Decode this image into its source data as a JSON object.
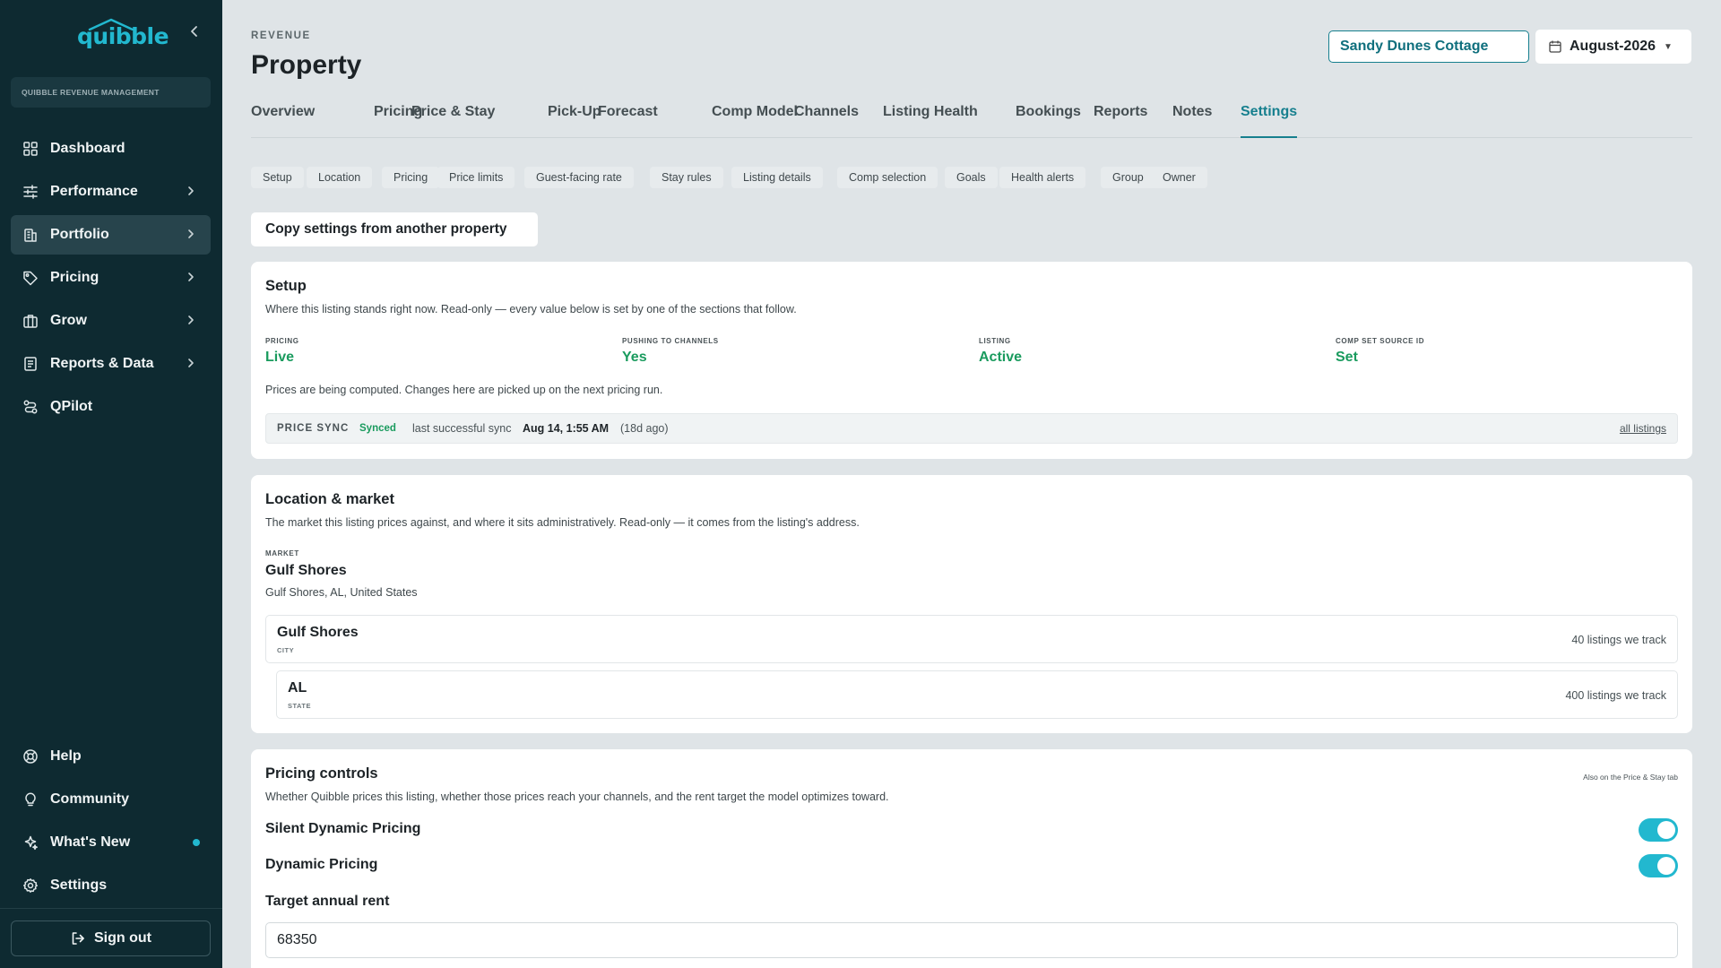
{
  "sidebar": {
    "logo_text": "quibble",
    "org_label": "QUIBBLE REVENUE MANAGEMENT",
    "nav_top": [
      {
        "label": "Dashboard",
        "icon": "dashboard-icon",
        "has_chevron": false,
        "active": false
      },
      {
        "label": "Performance",
        "icon": "sliders-icon",
        "has_chevron": true,
        "active": false
      },
      {
        "label": "Portfolio",
        "icon": "building-icon",
        "has_chevron": true,
        "active": true
      },
      {
        "label": "Pricing",
        "icon": "tag-icon",
        "has_chevron": true,
        "active": false
      },
      {
        "label": "Grow",
        "icon": "briefcase-icon",
        "has_chevron": true,
        "active": false
      },
      {
        "label": "Reports & Data",
        "icon": "document-icon",
        "has_chevron": true,
        "active": false
      },
      {
        "label": "QPilot",
        "icon": "route-icon",
        "has_chevron": false,
        "active": false
      }
    ],
    "nav_bottom": [
      {
        "label": "Help",
        "icon": "lifebuoy-icon"
      },
      {
        "label": "Community",
        "icon": "lightbulb-icon"
      },
      {
        "label": "What's New",
        "icon": "sparkles-icon",
        "has_dot": true
      },
      {
        "label": "Settings",
        "icon": "gear-icon"
      }
    ],
    "signout_label": "Sign out"
  },
  "header": {
    "eyebrow": "REVENUE",
    "title": "Property",
    "property_value": "Sandy Dunes Cottage",
    "date_label": "August-2026"
  },
  "tabs": [
    "Overview",
    "Pricing",
    "Price & Stay",
    "Pick-Up",
    "Forecast",
    "Comp Model",
    "Channels",
    "Listing Health",
    "Bookings",
    "Reports",
    "Notes",
    "Settings"
  ],
  "active_tab": "Settings",
  "subtabs": [
    "Setup",
    "Location",
    "Pricing",
    "Price limits",
    "Guest-facing rate",
    "Stay rules",
    "Listing details",
    "Comp selection",
    "Goals",
    "Health alerts",
    "Group",
    "Owner"
  ],
  "copy_button": "Copy settings from another property",
  "setup": {
    "title": "Setup",
    "description": "Where this listing stands right now. Read-only — every value below is set by one of the sections that follow.",
    "stats": [
      {
        "label": "PRICING",
        "value": "Live"
      },
      {
        "label": "PUSHING TO CHANNELS",
        "value": "Yes"
      },
      {
        "label": "LISTING",
        "value": "Active"
      },
      {
        "label": "COMP SET SOURCE ID",
        "value": "Set"
      }
    ],
    "note": "Prices are being computed. Changes here are picked up on the next pricing run.",
    "sync": {
      "label": "PRICE SYNC",
      "status": "Synced",
      "prefix": "last successful sync",
      "time": "Aug 14, 1:55 AM",
      "ago": "(18d ago)",
      "link": "all listings"
    }
  },
  "location": {
    "title": "Location & market",
    "description": "The market this listing prices against, and where it sits administratively. Read-only — it comes from the listing's address.",
    "market_label": "MARKET",
    "market_name": "Gulf Shores",
    "market_address": "Gulf Shores, AL, United States",
    "rows": [
      {
        "name": "Gulf Shores",
        "type": "CITY",
        "count": "40 listings we track"
      },
      {
        "name": "AL",
        "type": "STATE",
        "count": "400 listings we track"
      }
    ]
  },
  "pricing_controls": {
    "title": "Pricing controls",
    "aside": "Also on the Price & Stay tab",
    "description": "Whether Quibble prices this listing, whether those prices reach your channels, and the rent target the model optimizes toward.",
    "toggles": [
      {
        "label": "Silent Dynamic Pricing",
        "on": true
      },
      {
        "label": "Dynamic Pricing",
        "on": true
      }
    ],
    "target_label": "Target annual rent",
    "target_value": "68350"
  },
  "colors": {
    "accent": "#22b8cf",
    "sidebar_bg": "#0e2a31",
    "positive": "#1a9b5e",
    "tab_active": "#167f8e"
  }
}
